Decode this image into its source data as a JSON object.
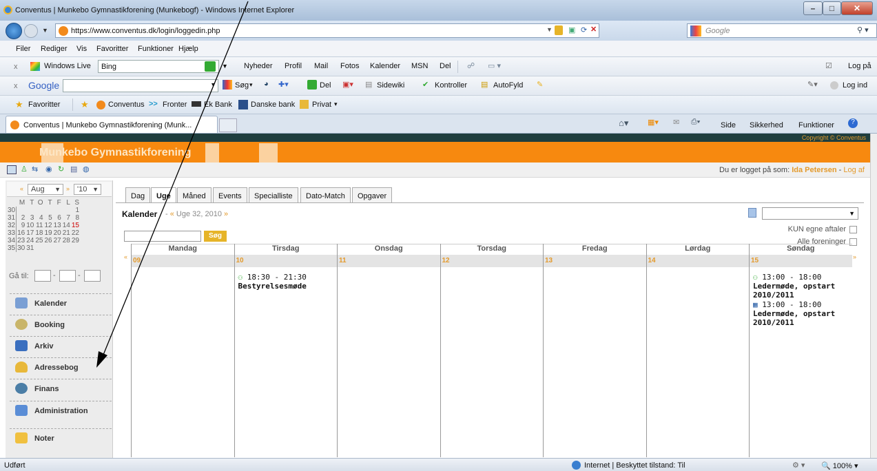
{
  "window": {
    "title": "Conventus | Munkebo Gymnastikforening (Munkebogf) - Windows Internet Explorer"
  },
  "address": {
    "url": "https://www.conventus.dk/login/loggedin.php",
    "search_placeholder": "Google"
  },
  "menu": [
    "Filer",
    "Rediger",
    "Vis",
    "Favoritter",
    "Funktioner",
    "Hjælp"
  ],
  "toolbar1": {
    "brand": "Windows Live",
    "search_value": "Bing",
    "links": [
      "Nyheder",
      "Profil",
      "Mail",
      "Fotos",
      "Kalender",
      "MSN",
      "Del"
    ],
    "login": "Log på"
  },
  "toolbar2": {
    "brand": "Google",
    "items": [
      "Søg",
      "Del",
      "Sidewiki",
      "Kontroller",
      "AutoFyld"
    ],
    "login": "Log ind"
  },
  "favorites": {
    "label": "Favoritter",
    "items": [
      "Conventus",
      "Fronter",
      "Ek Bank",
      "Danske bank",
      "Privat"
    ]
  },
  "tab": {
    "label": "Conventus | Munkebo Gymnastikforening (Munk...",
    "cmd": [
      "Side",
      "Sikkerhed",
      "Funktioner"
    ]
  },
  "page": {
    "copyright": "Copyright © Conventus",
    "org_name": "Munkebo Gymnastikforening",
    "logged_in_prefix": "Du er logget på som:",
    "user": "Ida Petersen",
    "logout": "Log af",
    "month": "Aug",
    "year": "'10",
    "cal_head": [
      "M",
      "T",
      "O",
      "T",
      "F",
      "L",
      "S"
    ],
    "cal_weeks": [
      {
        "w": "30",
        "d": [
          "",
          "",
          "",
          "",
          "",
          "",
          "1"
        ]
      },
      {
        "w": "31",
        "d": [
          "2",
          "3",
          "4",
          "5",
          "6",
          "7",
          "8"
        ]
      },
      {
        "w": "32",
        "d": [
          "9",
          "10",
          "11",
          "12",
          "13",
          "14",
          "15"
        ]
      },
      {
        "w": "33",
        "d": [
          "16",
          "17",
          "18",
          "19",
          "20",
          "21",
          "22"
        ]
      },
      {
        "w": "34",
        "d": [
          "23",
          "24",
          "25",
          "26",
          "27",
          "28",
          "29"
        ]
      },
      {
        "w": "35",
        "d": [
          "30",
          "31",
          "",
          "",
          "",
          "",
          ""
        ]
      }
    ],
    "goto": "Gå til:",
    "nav": [
      "Kalender",
      "Booking",
      "Arkiv",
      "Adressebog",
      "Finans",
      "Administration",
      "Noter"
    ],
    "tabs": [
      "Dag",
      "Uge",
      "Måned",
      "Events",
      "Specialliste",
      "Dato-Match",
      "Opgaver"
    ],
    "kalender": "Kalender",
    "week_label": "Uge 32, 2010",
    "search_btn": "Søg",
    "opt1": "KUN egne aftaler",
    "opt2": "Alle foreninger",
    "days": [
      {
        "name": "Mandag",
        "num": "09",
        "events": []
      },
      {
        "name": "Tirsdag",
        "num": "10",
        "events": [
          {
            "time": "18:30 - 21:30",
            "title": "Bestyrelsesmøde"
          }
        ]
      },
      {
        "name": "Onsdag",
        "num": "11",
        "events": []
      },
      {
        "name": "Torsdag",
        "num": "12",
        "events": []
      },
      {
        "name": "Fredag",
        "num": "13",
        "events": []
      },
      {
        "name": "Lørdag",
        "num": "14",
        "events": []
      },
      {
        "name": "Søndag",
        "num": "15",
        "events": [
          {
            "time": "13:00 - 18:00",
            "title": "Ledermøde, opstart 2010/2011"
          },
          {
            "time": "13:00 - 18:00",
            "title": "Ledermøde, opstart 2010/2011"
          }
        ]
      }
    ]
  },
  "status": {
    "left": "Udført",
    "zone": "Internet | Beskyttet tilstand: Til",
    "zoom": "100%"
  }
}
